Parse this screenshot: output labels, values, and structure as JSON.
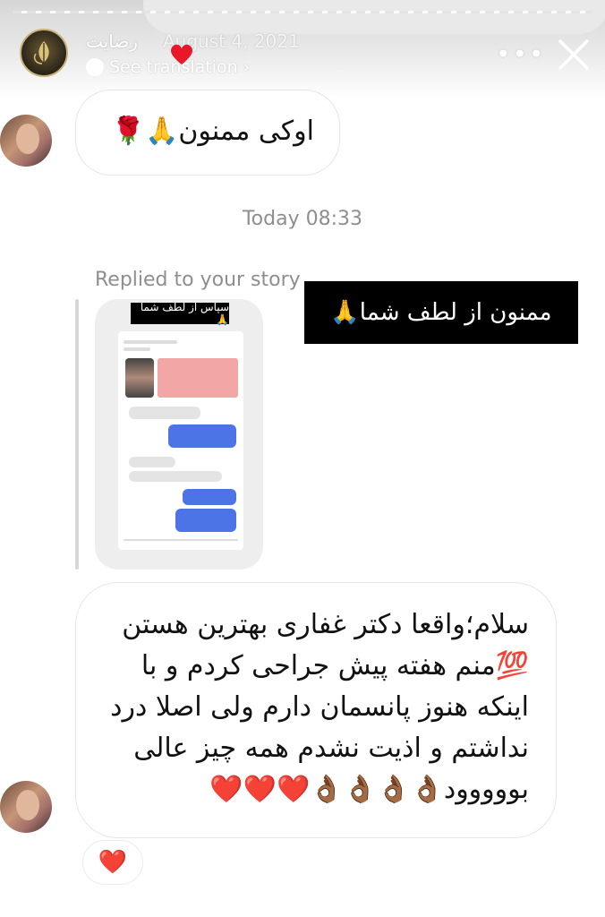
{
  "header": {
    "username": "رضایت",
    "date": "August 4, 2021",
    "see_translation": "See translation",
    "chevron": "›",
    "more_icon": "more-dots-icon",
    "close_icon": "close-icon"
  },
  "messages": [
    {
      "sender": "other",
      "text": "اوکی ممنون🙏🌹"
    }
  ],
  "timestamp": "Today 08:33",
  "reply": {
    "replied_label": "Replied to your story",
    "story_caption": "سپاس از لطف شما🙏",
    "story_label": "ممنون از لطف شما🙏"
  },
  "message2": {
    "lines": [
      "سلام؛واقعا دکتر غفاری بهترین هستن",
      "💯منم هفته پیش جراحی کردم و با",
      "اینکه هنوز پانسمان دارم ولی اصلا درد",
      "نداشتم و اذیت نشدم همه چیز عالی",
      "بووووود👌🏾👌🏾👌🏾👌🏾❤️❤️❤️"
    ],
    "reaction": "❤️"
  },
  "colors": {
    "heart": "#e8182b",
    "muted_text": "#8e8e8e",
    "bubble_border": "#e6e6e6",
    "story_label_bg": "#000000"
  }
}
